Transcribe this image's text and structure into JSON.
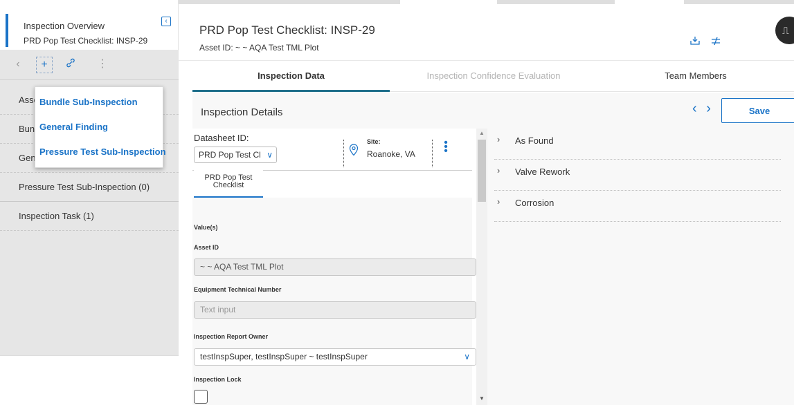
{
  "sidebar": {
    "title": "Inspection Overview",
    "subtitle": "PRD Pop Test Checklist: INSP-29",
    "collapse_icon": "collapse-left-icon",
    "toolbar": {
      "back_icon": "‹",
      "add_icon": "+",
      "link_icon": "🔗",
      "more_icon": "⋮"
    },
    "items": [
      {
        "label": "Asset"
      },
      {
        "label": "Bundle Sub-Inspection"
      },
      {
        "label": "General Finding"
      },
      {
        "label": "Pressure Test Sub-Inspection (0)"
      },
      {
        "label": "Inspection Task (1)"
      }
    ],
    "items_visible_prefix": [
      "Asse",
      "Bun",
      "Gen"
    ]
  },
  "popup_menu": {
    "items": [
      "Bundle Sub-Inspection",
      "General Finding",
      "Pressure Test Sub-Inspection"
    ]
  },
  "header": {
    "title": "PRD Pop Test Checklist: INSP-29",
    "subtitle": "Asset ID: ~ ~ AQA Test TML Plot",
    "icons": [
      "download-icon",
      "compare-icon"
    ]
  },
  "side_tab_icon": "panel-toggle-icon",
  "tabs": [
    {
      "label": "Inspection Data",
      "active": true
    },
    {
      "label": "Inspection Confidence Evaluation",
      "active": false
    },
    {
      "label": "Team Members",
      "active": false
    }
  ],
  "section": {
    "title": "Inspection Details",
    "save_label": "Save",
    "nav_label": "‹ ›"
  },
  "form": {
    "datasheet_label": "Datasheet ID:",
    "datasheet_value": "PRD Pop Test Cl",
    "site_label": "Site:",
    "site_value": "Roanoke, VA",
    "subtab_label_1": "PRD Pop Test",
    "subtab_label_2": "Checklist",
    "values_label": "Value(s)",
    "fields": [
      {
        "label": "Asset ID",
        "value": "~ ~ AQA Test TML Plot",
        "placeholder": ""
      },
      {
        "label": "Equipment Technical Number",
        "value": "",
        "placeholder": "Text input"
      },
      {
        "label": "Inspection Report Owner",
        "value": "testInspSuper, testInspSuper ~ testInspSuper",
        "placeholder": ""
      },
      {
        "label": "Inspection Lock",
        "value": "",
        "placeholder": ""
      }
    ]
  },
  "accordion": [
    {
      "label": "As Found"
    },
    {
      "label": "Valve Rework"
    },
    {
      "label": "Corrosion"
    }
  ],
  "colors": {
    "accent": "#1a73c7",
    "tab_underline": "#1f6f8b",
    "sidebar_bg": "#e6e6e6",
    "panel_bg": "#f8f8f8"
  }
}
